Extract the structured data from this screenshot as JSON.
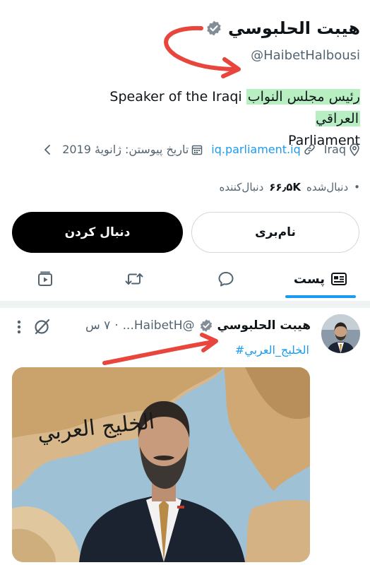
{
  "profile": {
    "display_name": "هيبت الحلبوسي",
    "handle": "@HaibetHalbousi",
    "bio_prefix": "Speaker of the Iraqi ",
    "bio_highlight": "رئيس مجلس النواب العراقي",
    "bio_line2": "Parliament",
    "location": "Iraq",
    "website": "iq.parliament.iq",
    "joined": "تاریخ پیوستن: ژانویهٔ 2019",
    "following_label": "دنبال‌شده",
    "followers_count": "۶۶٫۵K",
    "followers_label": "دنبال‌کننده"
  },
  "buttons": {
    "follow": "دنبال کردن",
    "notify": "نام‌بری"
  },
  "tabs": {
    "posts": "پست"
  },
  "tweet": {
    "display_name": "هيبت الحلبوسي",
    "handle": "@HaibetH...",
    "time": "۷ س",
    "hashtag": "#الخليج_العربي",
    "image_caption": "الخليج العربي"
  },
  "colors": {
    "accent": "#1d9bf0",
    "highlight": "#b8efc2",
    "annotation": "#e8453c"
  },
  "icons": [
    "verified-badge-icon",
    "location-icon",
    "link-icon",
    "calendar-icon",
    "chevron-left-icon",
    "posts-tab-icon",
    "chat-icon",
    "retweet-icon",
    "video-icon",
    "grok-icon",
    "more-icon"
  ]
}
